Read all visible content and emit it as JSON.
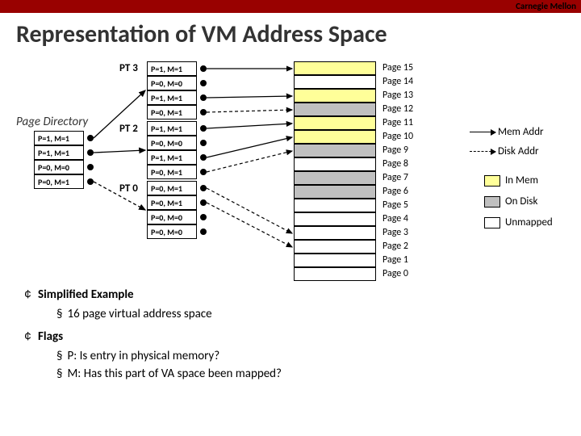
{
  "brand": "Carnegie Mellon",
  "title": "Representation of VM Address Space",
  "page_dir": {
    "label": "Page Directory",
    "entries": [
      "P=1, M=1",
      "P=1, M=1",
      "P=0, M=0",
      "P=0, M=1"
    ]
  },
  "page_tables": {
    "pt3": {
      "label": "PT 3",
      "entries": [
        "P=1, M=1",
        "P=0, M=0",
        "P=1, M=1",
        "P=0, M=1"
      ]
    },
    "pt2": {
      "label": "PT 2",
      "entries": [
        "P=1, M=1",
        "P=0, M=0",
        "P=1, M=1",
        "P=0, M=1"
      ]
    },
    "pt0": {
      "label": "PT 0",
      "entries": [
        "P=0, M=1",
        "P=0, M=1",
        "P=0, M=0",
        "P=0, M=0"
      ]
    }
  },
  "pages": {
    "labels": [
      "Page 15",
      "Page 14",
      "Page 13",
      "Page 12",
      "Page 11",
      "Page 10",
      "Page 9",
      "Page 8",
      "Page 7",
      "Page 6",
      "Page 5",
      "Page 4",
      "Page 3",
      "Page 2",
      "Page 1",
      "Page 0"
    ],
    "fill": [
      "yellow",
      "white",
      "yellow",
      "gray",
      "yellow",
      "yellow",
      "gray",
      "white",
      "gray",
      "gray",
      "white",
      "white",
      "white",
      "white",
      "white",
      "white"
    ]
  },
  "legend": {
    "mem_addr": "Mem Addr",
    "disk_addr": "Disk Addr",
    "in_mem": "In Mem",
    "on_disk": "On Disk",
    "unmapped": "Unmapped"
  },
  "notes": {
    "h1": "Simplified Example",
    "b1": "16 page virtual address space",
    "h2": "Flags",
    "b2": "P: Is entry in physical memory?",
    "b3": "M: Has this part of VA space been mapped?"
  },
  "colors": {
    "yellow": "#ffff99",
    "gray": "#c0c0c0",
    "red": "#990100"
  }
}
